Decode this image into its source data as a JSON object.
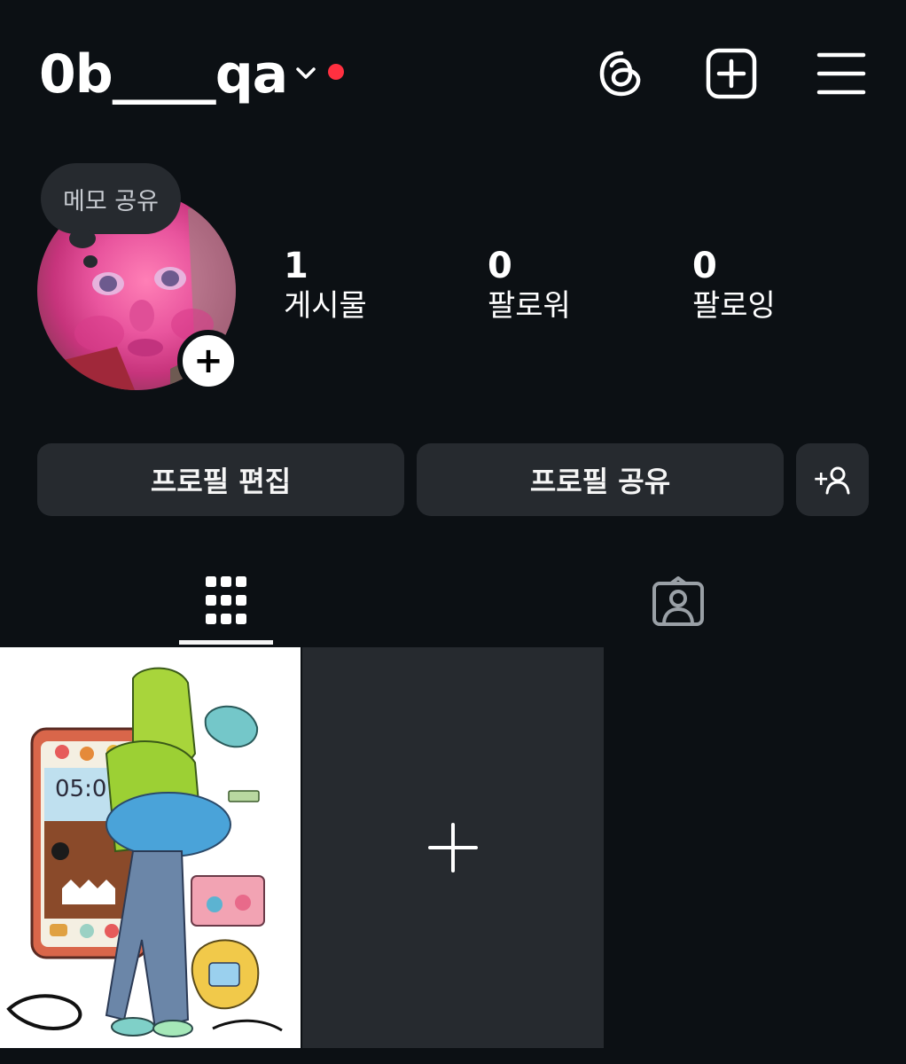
{
  "header": {
    "username": "0b____qa",
    "icons": {
      "threads": "threads-icon",
      "create": "plus-square-icon",
      "menu": "hamburger-icon"
    },
    "notification_color": "#ff3040"
  },
  "profile": {
    "memo_label": "메모 공유",
    "add_story_label": "+",
    "stats": [
      {
        "value": "1",
        "label": "게시물"
      },
      {
        "value": "0",
        "label": "팔로워"
      },
      {
        "value": "0",
        "label": "팔로잉"
      }
    ]
  },
  "actions": {
    "edit_profile": "프로필 편집",
    "share_profile": "프로필 공유",
    "discover_people_label": "+"
  },
  "tabs": [
    {
      "name": "posts",
      "icon": "grid-icon",
      "selected": true
    },
    {
      "name": "tagged",
      "icon": "tagged-person-icon",
      "selected": false
    }
  ],
  "posts": {
    "tile_1": {
      "phone_clock": "05:01"
    },
    "add_tile_label": "+"
  },
  "colors": {
    "background": "#0c1014",
    "surface": "#262a2f",
    "text": "#f5f5f5"
  }
}
